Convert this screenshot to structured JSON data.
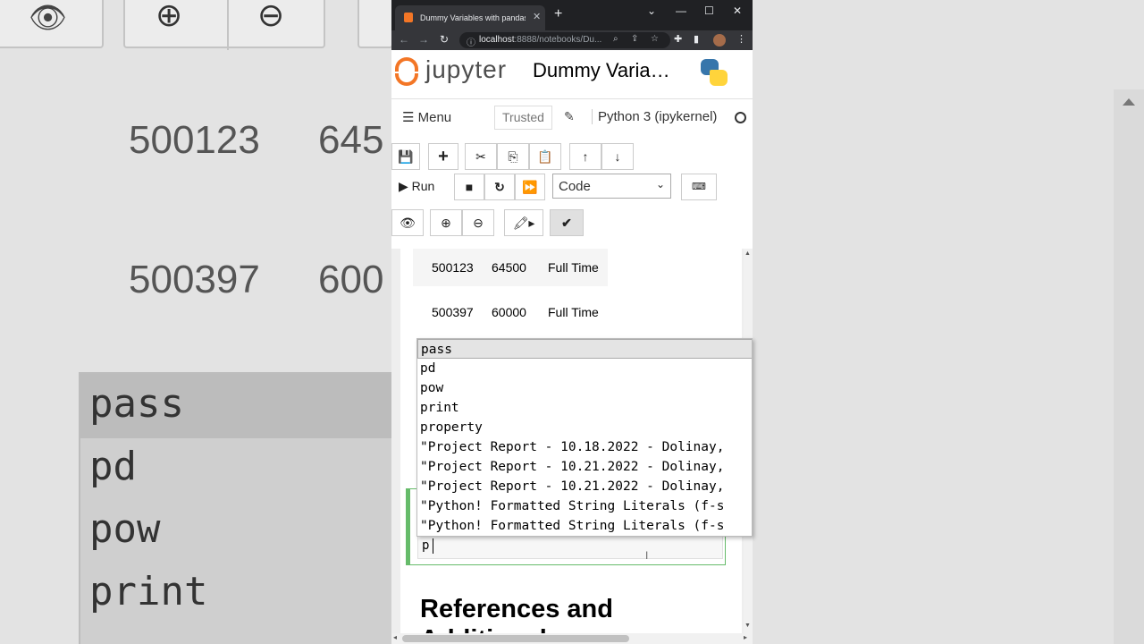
{
  "background": {
    "numbers": [
      "500123",
      "645",
      "500397",
      "600"
    ],
    "autocomplete": [
      "pass",
      "pd",
      "pow",
      "print"
    ]
  },
  "browser": {
    "tab_title": "Dummy Variables with pandas! -",
    "tab_close": "✕",
    "new_tab": "+",
    "url_host": "localhost",
    "url_rest": ":8888/notebooks/Du...",
    "window_controls": [
      "⌄",
      "—",
      "☐",
      "✕"
    ]
  },
  "jupyter": {
    "brand": "jupyter",
    "notebook_title": "Dummy Varia…",
    "menu_label": "Menu",
    "trusted_label": "Trusted",
    "kernel_label": "Python 3 (ipykernel)",
    "run_label": "Run",
    "cell_type": "Code"
  },
  "table": {
    "rows": [
      [
        "500123",
        "64500",
        "Full Time"
      ],
      [
        "500397",
        "60000",
        "Full Time"
      ]
    ]
  },
  "cell": {
    "input": "p"
  },
  "autocomplete": {
    "items": [
      "pass",
      "pd",
      "pow",
      "print",
      "property",
      "\"Project Report - 10.18.2022 - Dolinay,",
      "\"Project Report - 10.21.2022 - Dolinay,",
      "\"Project Report - 10.21.2022 - Dolinay,",
      "\"Python! Formatted String Literals (f-s",
      "\"Python! Formatted String Literals (f-s"
    ],
    "selected_index": 0
  },
  "markdown": {
    "heading_line1": "References and",
    "heading_line2": "Additional"
  },
  "colors": {
    "jupyter_orange": "#f37626",
    "cell_green": "#66bb6a",
    "chrome_dark": "#202124"
  }
}
